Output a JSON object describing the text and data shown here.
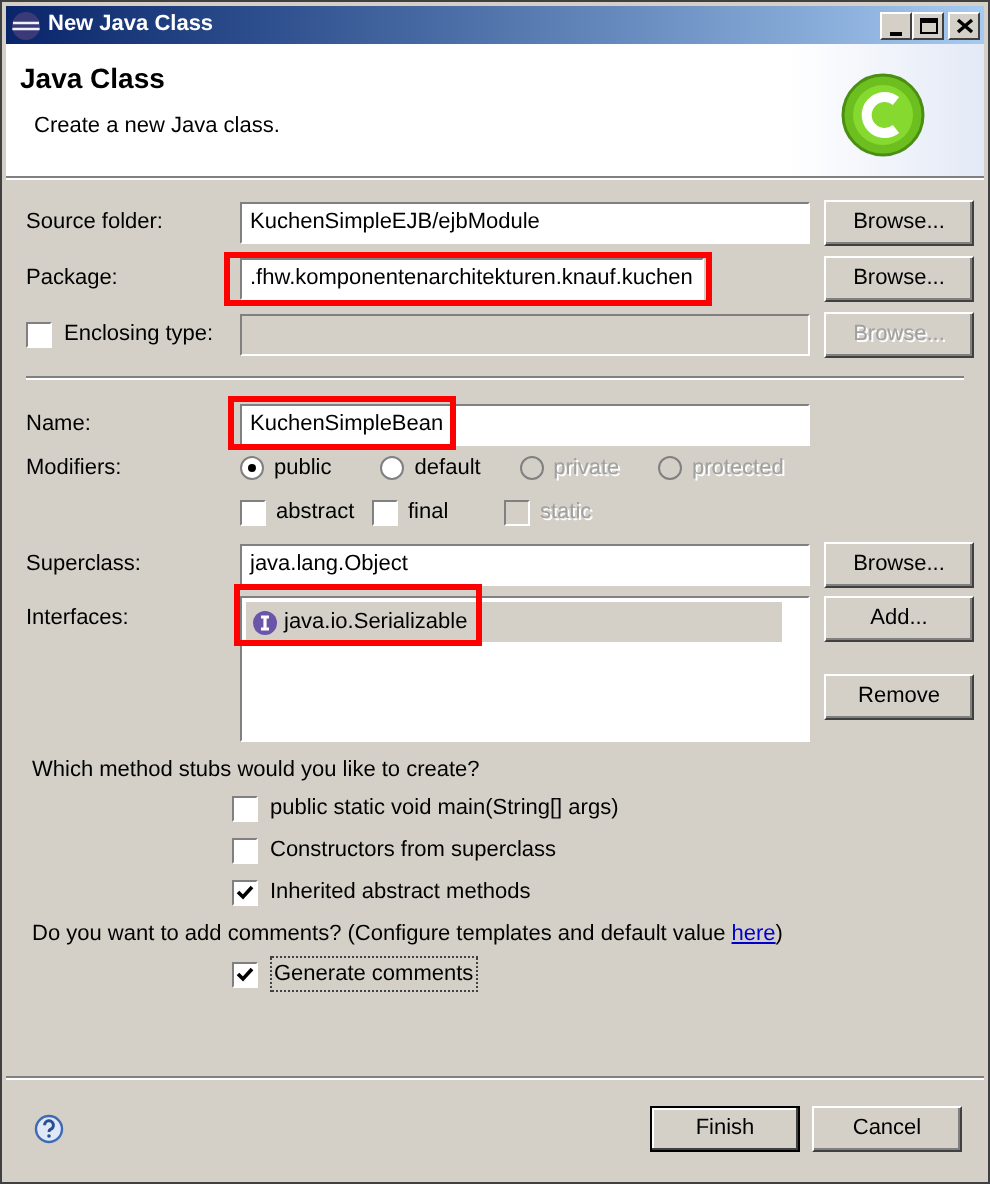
{
  "window": {
    "title": "New Java Class"
  },
  "header": {
    "title": "Java Class",
    "description": "Create a new Java class."
  },
  "source_folder": {
    "label": "Source folder:",
    "value": "KuchenSimpleEJB/ejbModule",
    "highlighted": false,
    "button": {
      "label": "Browse...",
      "disabled": false
    }
  },
  "package": {
    "label": "Package:",
    "value": ".fhw.komponentenarchitekturen.knauf.kuchen",
    "highlighted": true,
    "button": {
      "label": "Browse...",
      "disabled": false
    }
  },
  "enclosing_type": {
    "label": "Enclosing type:",
    "checked": false,
    "button": {
      "label": "Browse...",
      "disabled": true
    }
  },
  "name": {
    "label": "Name:",
    "value": "KuchenSimpleBean",
    "highlighted": true
  },
  "modifiers": {
    "label": "Modifiers:",
    "visibility": [
      {
        "label": "public",
        "selected": true,
        "disabled": false
      },
      {
        "label": "default",
        "selected": false,
        "disabled": false
      },
      {
        "label": "private",
        "selected": false,
        "disabled": true
      },
      {
        "label": "protected",
        "selected": false,
        "disabled": true
      }
    ],
    "flags": [
      {
        "label": "abstract",
        "checked": false,
        "disabled": false
      },
      {
        "label": "final",
        "checked": false,
        "disabled": false
      },
      {
        "label": "static",
        "checked": false,
        "disabled": true
      }
    ]
  },
  "superclass": {
    "label": "Superclass:",
    "value": "java.lang.Object",
    "button": {
      "label": "Browse..."
    }
  },
  "interfaces": {
    "label": "Interfaces:",
    "highlighted": true,
    "items": [
      {
        "name": "java.io.Serializable",
        "selected": true
      }
    ],
    "buttons": [
      {
        "label": "Add..."
      },
      {
        "label": "Remove"
      }
    ]
  },
  "method_stubs": {
    "question": "Which method stubs would you like to create?",
    "options": [
      {
        "label": "public static void main(String[] args)",
        "checked": false
      },
      {
        "label": "Constructors from superclass",
        "checked": false
      },
      {
        "label": "Inherited abstract methods",
        "checked": true
      }
    ]
  },
  "comments": {
    "question_start": "Do you want to add comments? (Configure templates and default value ",
    "link": "here",
    "question_end": ")",
    "option": {
      "label": "Generate comments",
      "checked": true
    }
  },
  "footer": {
    "buttons": [
      {
        "label": "Finish",
        "default": true
      },
      {
        "label": "Cancel",
        "default": false
      }
    ]
  }
}
